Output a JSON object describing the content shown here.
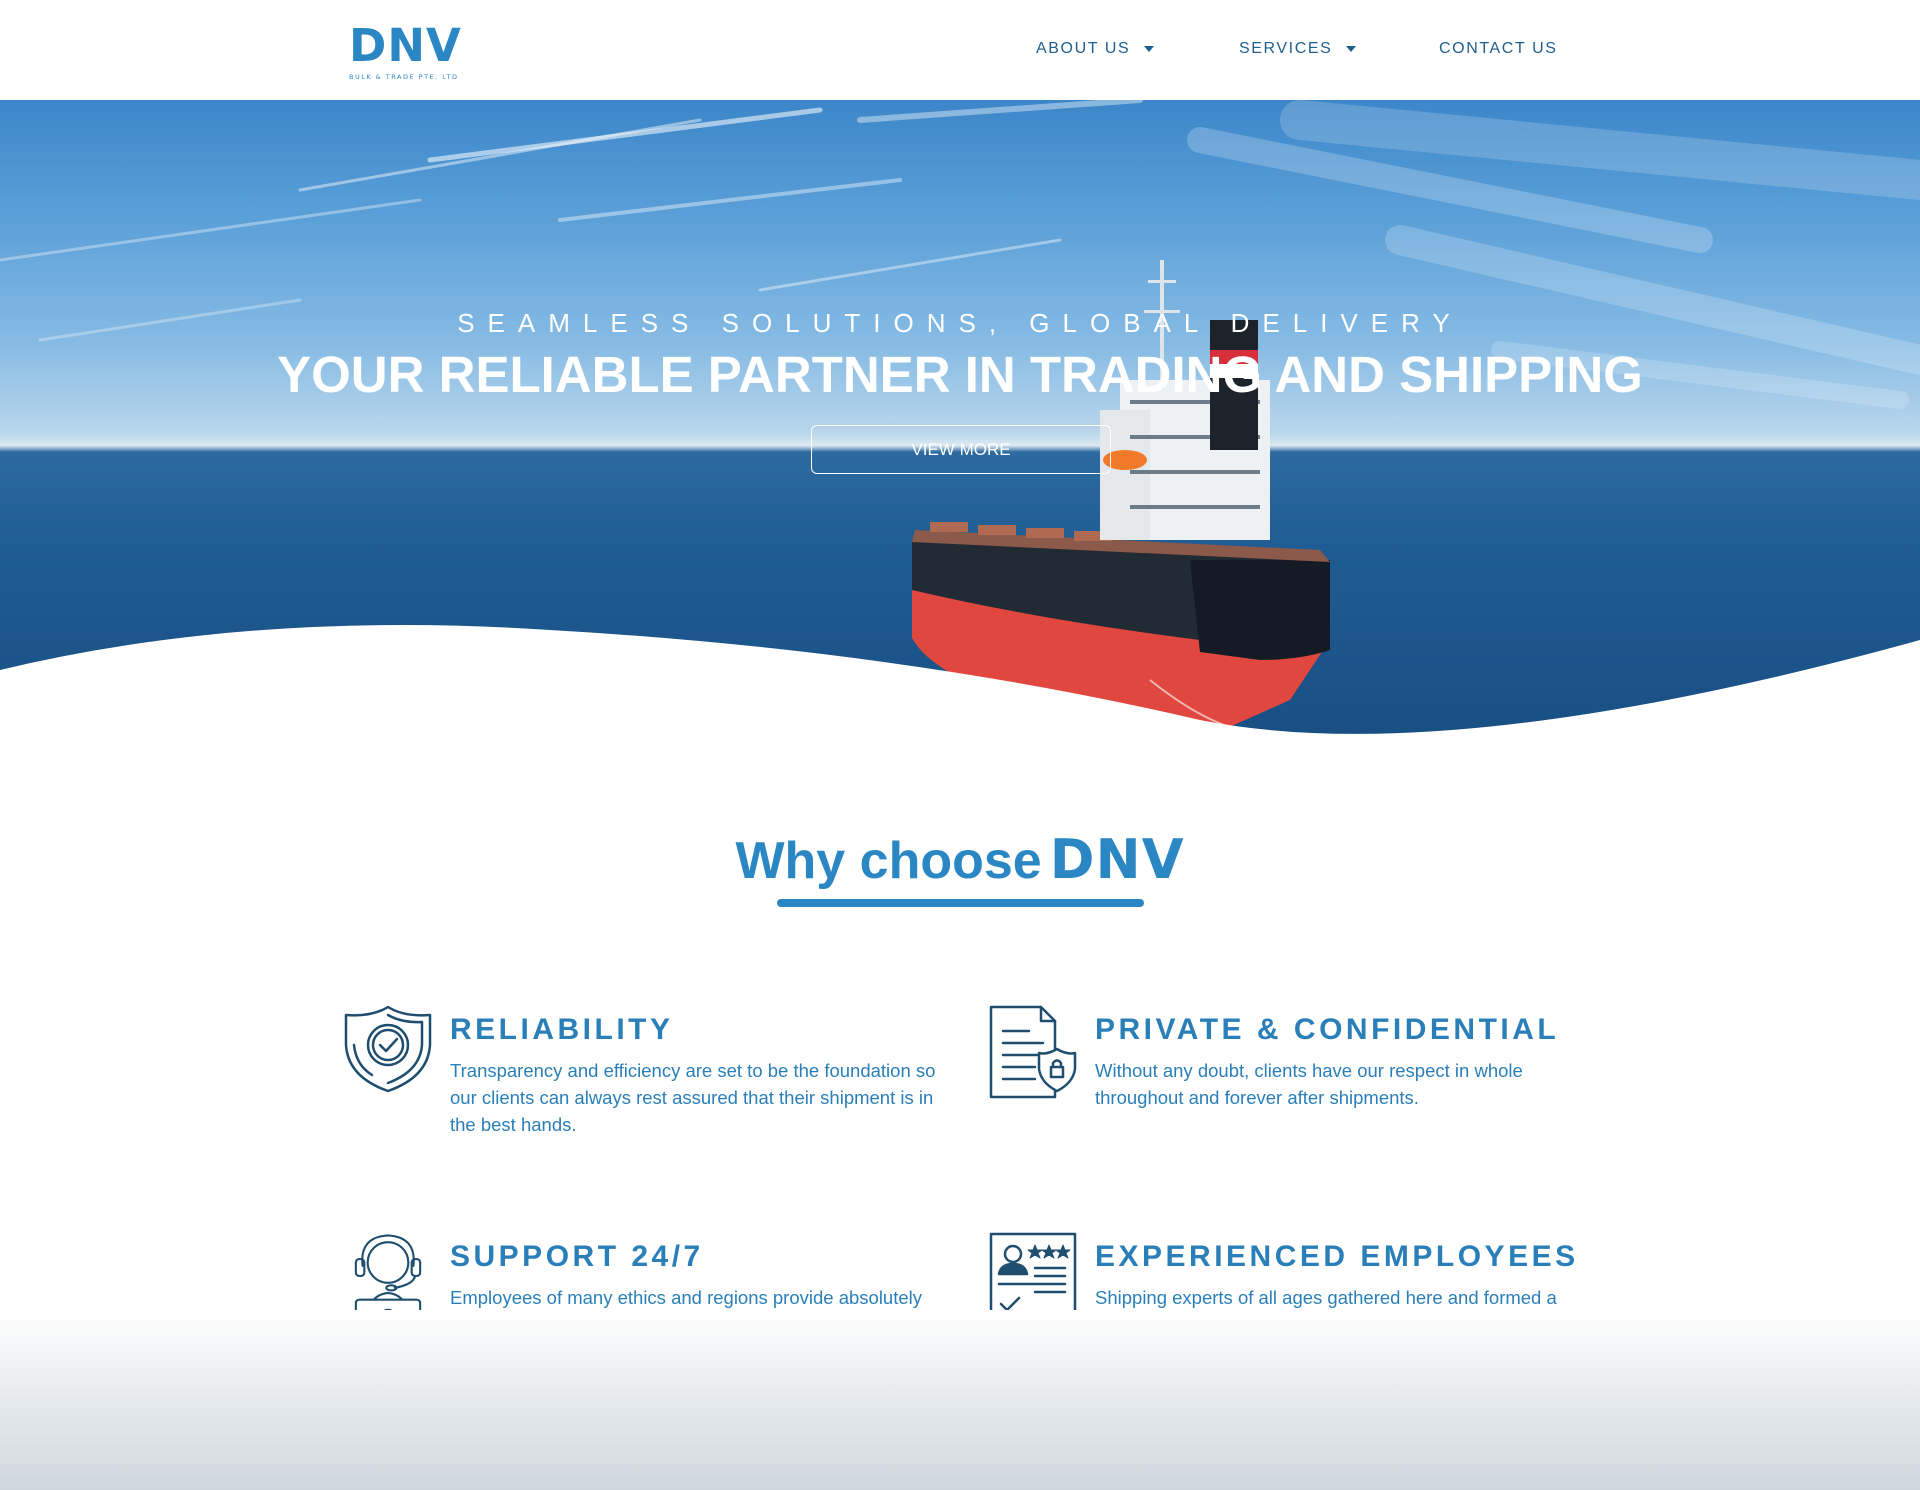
{
  "brand": {
    "name": "DNV",
    "tagline": "BULK & TRADE PTE. LTD",
    "color": "#2a87c4"
  },
  "nav": {
    "items": [
      {
        "label": "ABOUT US",
        "has_dropdown": true
      },
      {
        "label": "SERVICES",
        "has_dropdown": true
      },
      {
        "label": "CONTACT US",
        "has_dropdown": false
      }
    ]
  },
  "hero": {
    "kicker": "SEAMLESS SOLUTIONS, GLOBAL DELIVERY",
    "title": "YOUR RELIABLE PARTNER IN TRADING AND SHIPPING",
    "button_label": "VIEW MORE"
  },
  "why": {
    "heading_prefix": "Why choose",
    "heading_brand": "DNV",
    "features": [
      {
        "icon": "shield-check-icon",
        "title": "RELIABILITY",
        "text": "Transparency and efficiency are set to be the foundation so our clients can always rest assured that their shipment is in the best hands."
      },
      {
        "icon": "secure-document-icon",
        "title": "PRIVATE & CONFIDENTIAL",
        "text": "Without any doubt, clients have our respect in whole throughout and forever after shipments."
      },
      {
        "icon": "support-agent-icon",
        "title": "SUPPORT 24/7",
        "text": "Employees of many ethics and regions provide absolutely zero downtime to our support."
      },
      {
        "icon": "employee-profile-icon",
        "title": "EXPERIENCED EMPLOYEES",
        "text": "Shipping experts of all ages gathered here and formed a completely flawless execution team."
      }
    ]
  },
  "colors": {
    "accent": "#2a87c4",
    "text": "#2a7fb8",
    "nav_text": "#1f5f8d",
    "icon_stroke": "#1f4e6e"
  }
}
